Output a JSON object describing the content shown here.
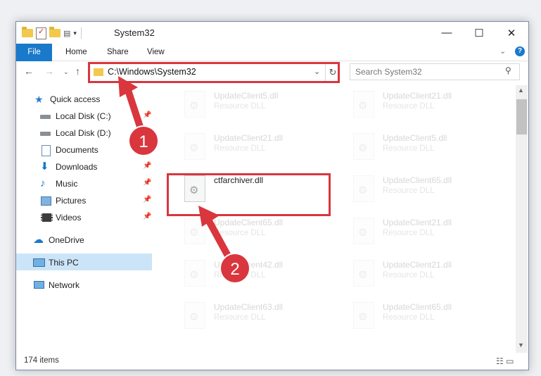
{
  "window": {
    "title": "System32",
    "minimize": "—",
    "maximize": "☐",
    "close": "✕"
  },
  "ribbon": {
    "tabs": [
      "File",
      "Home",
      "Share",
      "View"
    ],
    "help": "?"
  },
  "navbar": {
    "address": "C:\\Windows\\System32",
    "search_placeholder": "Search System32"
  },
  "sidebar": {
    "items": [
      {
        "label": "Quick access",
        "icon": "star-icon"
      },
      {
        "label": "Local Disk (C:)",
        "icon": "drive-icon",
        "pinned": true
      },
      {
        "label": "Local Disk (D:)",
        "icon": "drive-icon"
      },
      {
        "label": "Documents",
        "icon": "documents-icon",
        "pinned": true
      },
      {
        "label": "Downloads",
        "icon": "download-icon",
        "pinned": true
      },
      {
        "label": "Music",
        "icon": "music-icon",
        "pinned": true
      },
      {
        "label": "Pictures",
        "icon": "pictures-icon",
        "pinned": true
      },
      {
        "label": "Videos",
        "icon": "videos-icon",
        "pinned": true
      },
      {
        "label": "OneDrive",
        "icon": "cloud-icon"
      },
      {
        "label": "This PC",
        "icon": "pc-icon",
        "selected": true
      },
      {
        "label": "Network",
        "icon": "network-icon"
      }
    ]
  },
  "files": [
    {
      "name": "UpdateClient5.dll",
      "type": "Resource DLL"
    },
    {
      "name": "UpdateClient21.dll",
      "type": "Resource DLL"
    },
    {
      "name": "UpdateClient21.dll",
      "type": "Resource DLL"
    },
    {
      "name": "UpdateClient5.dll",
      "type": "Resource DLL"
    },
    {
      "name": "ctfarchiver.dll",
      "type": "",
      "highlighted": true
    },
    {
      "name": "UpdateClient65.dll",
      "type": "Resource DLL"
    },
    {
      "name": "UpdateClient65.dll",
      "type": "Resource DLL"
    },
    {
      "name": "UpdateClient21.dll",
      "type": "Resource DLL"
    },
    {
      "name": "UpdateClient42.dll",
      "type": "Resource DLL"
    },
    {
      "name": "UpdateClient21.dll",
      "type": "Resource DLL"
    },
    {
      "name": "UpdateClient63.dll",
      "type": "Resource DLL"
    },
    {
      "name": "UpdateClient65.dll",
      "type": "Resource DLL"
    }
  ],
  "status": {
    "item_count": "174 items"
  },
  "annotations": {
    "step1": "1",
    "step2": "2",
    "color": "#d9363e"
  }
}
